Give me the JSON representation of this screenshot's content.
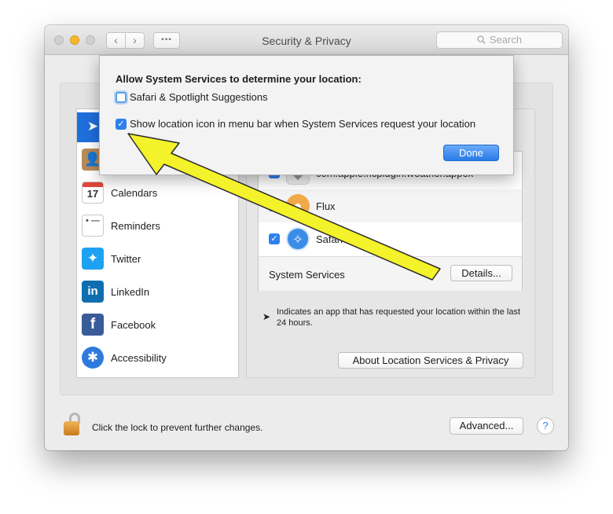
{
  "window": {
    "title": "Security & Privacy",
    "search_placeholder": "Search",
    "nav_back": "‹",
    "nav_forward": "›",
    "grid_glyph": "▪▪▪"
  },
  "sidebar": {
    "items": [
      {
        "label": "",
        "icon": "location-icon",
        "glyph": "➤"
      },
      {
        "label": "",
        "icon": "contacts-icon",
        "glyph": "👤"
      },
      {
        "label": "Calendars",
        "icon": "calendar-icon",
        "glyph": "17"
      },
      {
        "label": "Reminders",
        "icon": "reminders-icon",
        "glyph": "• —"
      },
      {
        "label": "Twitter",
        "icon": "twitter-icon",
        "glyph": "✦"
      },
      {
        "label": "LinkedIn",
        "icon": "linkedin-icon",
        "glyph": "in"
      },
      {
        "label": "Facebook",
        "icon": "facebook-icon",
        "glyph": "f"
      },
      {
        "label": "Accessibility",
        "icon": "accessibility-icon",
        "glyph": "✱"
      }
    ]
  },
  "apps": [
    {
      "label": "com.apple.ncplugin.weather.appex",
      "checked": true,
      "glyph": "◆"
    },
    {
      "label": "Flux",
      "checked": true,
      "glyph": "●"
    },
    {
      "label": "Safari",
      "checked": true,
      "glyph": "✧"
    }
  ],
  "system_services": {
    "label": "System Services",
    "details_button": "Details..."
  },
  "note": {
    "arrow_glyph": "➤",
    "text": "Indicates an app that has requested your location within the last 24 hours."
  },
  "about_button": "About Location Services & Privacy",
  "footer": {
    "lock_text": "Click the lock to prevent further changes.",
    "advanced_button": "Advanced...",
    "help_button": "?"
  },
  "popover": {
    "heading": "Allow System Services to determine your location:",
    "options": [
      {
        "label": "Safari & Spotlight Suggestions",
        "checked": false
      },
      {
        "label": "Show location icon in menu bar when System Services request your location",
        "checked": true
      }
    ],
    "done_button": "Done"
  },
  "colors": {
    "accent": "#2f80ed",
    "selection": "#1f6fdb",
    "annotation_arrow": "#f4f22a"
  },
  "check_glyph": "✓"
}
